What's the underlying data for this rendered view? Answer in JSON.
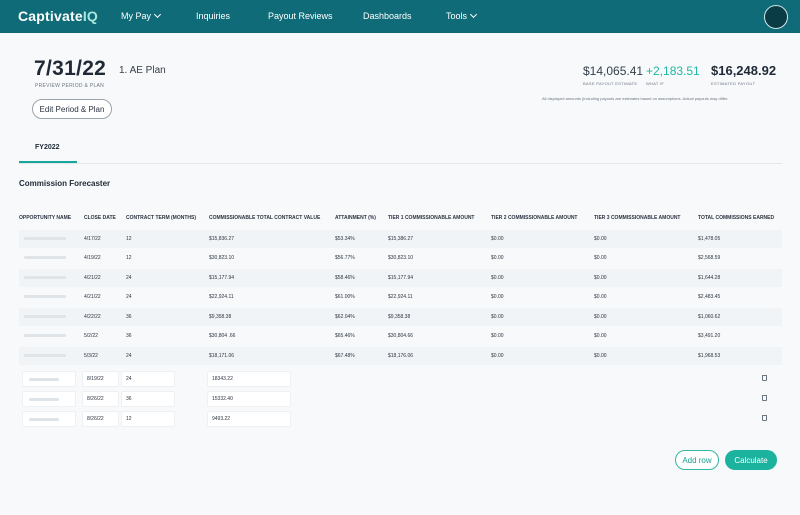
{
  "nav": {
    "brand_main": "Captivate",
    "brand_accent": "IQ",
    "items": [
      {
        "label": "My Pay",
        "has_dropdown": true
      },
      {
        "label": "Inquiries",
        "has_dropdown": false
      },
      {
        "label": "Payout Reviews",
        "has_dropdown": false
      },
      {
        "label": "Dashboards",
        "has_dropdown": false
      },
      {
        "label": "Tools",
        "has_dropdown": true
      }
    ],
    "bg_color": "#0f6b78"
  },
  "header": {
    "date": "7/31/22",
    "date_label": "PREVIEW PERIOD & PLAN",
    "plan": "1. AE Plan",
    "edit_button": "Edit Period & Plan",
    "metrics": [
      {
        "value": "$14,065.41",
        "label": "BASE PAYOUT ESTIMATE"
      },
      {
        "value": "+2,183.51",
        "label": "WHAT IF"
      },
      {
        "value": "$16,248.92",
        "label": "ESTIMATED PAYOUT"
      }
    ],
    "disclaimer": "All displayed amounts (including payouts are estimates based on assumptions. Actual payouts may differ."
  },
  "tabs": [
    {
      "label": "FY2022",
      "active": true
    }
  ],
  "section_title": "Commission Forecaster",
  "table": {
    "columns": [
      "OPPORTUNITY NAME",
      "CLOSE DATE",
      "CONTRACT TERM (MONTHS)",
      "COMMISSIONABLE TOTAL CONTRACT VALUE",
      "ATTAINMENT (%)",
      "TIER 1 COMMISSIONABLE AMOUNT",
      "TIER 2 COMMISSIONABLE AMOUNT",
      "TIER 3 COMMISSIONABLE AMOUNT",
      "TOTAL COMMISSIONS EARNED"
    ],
    "rows": [
      [
        "4/17/22",
        "12",
        "$15,836.27",
        "$53.34%",
        "$15,386.27",
        "$0.00",
        "$0.00",
        "$1,478.05"
      ],
      [
        "4/19/22",
        "12",
        "$30,823.10",
        "$56.77%",
        "$30,823.10",
        "$0.00",
        "$0.00",
        "$2,568.59"
      ],
      [
        "4/21/22",
        "24",
        "$15,177.94",
        "$58.46%",
        "$15,177.94",
        "$0.00",
        "$0.00",
        "$1,644.28"
      ],
      [
        "4/21/22",
        "24",
        "$22,924.11",
        "$61.00%",
        "$22,924.11",
        "$0.00",
        "$0.00",
        "$2,483.45"
      ],
      [
        "4/22/22",
        "36",
        "$9,358.38",
        "$62.04%",
        "$9,358.38",
        "$0.00",
        "$0.00",
        "$1,060.62"
      ],
      [
        "5/2/22",
        "36",
        "$30,804 .66",
        "$65.46%",
        "$30,804.66",
        "$0.00",
        "$0.00",
        "$3,491.20"
      ],
      [
        "5/3/22",
        "24",
        "$18,171.06",
        "$67.48%",
        "$18,176.06",
        "$0.00",
        "$0.00",
        "$1,968.53"
      ]
    ],
    "editable_rows": [
      {
        "close_date": "8/19/22",
        "term": "24",
        "value": "18343.22"
      },
      {
        "close_date": "8/26/22",
        "term": "36",
        "value": "15332.40"
      },
      {
        "close_date": "8/26/22",
        "term": "12",
        "value": "9493.22"
      }
    ]
  },
  "buttons": {
    "add_row": "Add row",
    "calculate": "Calculate"
  },
  "accent_color": "#1bb39e"
}
